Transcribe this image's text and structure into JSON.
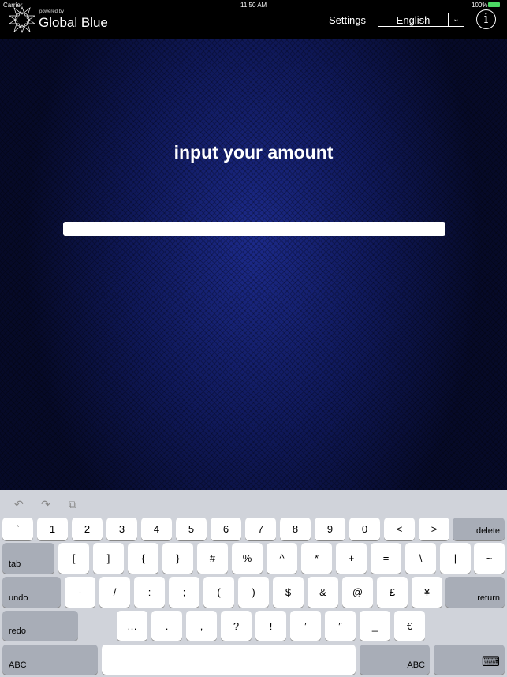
{
  "status": {
    "carrier": "Carrier",
    "time": "11:50 AM",
    "battery": "100%"
  },
  "header": {
    "powered_by": "powered by",
    "brand": "Global Blue",
    "settings": "Settings",
    "language": "English",
    "info": "i"
  },
  "main": {
    "title": "input your amount",
    "amount_value": ""
  },
  "keyboard": {
    "toolbar": [
      "undo-icon",
      "redo-icon",
      "paste-icon"
    ],
    "rows": [
      [
        "`",
        "1",
        "2",
        "3",
        "4",
        "5",
        "6",
        "7",
        "8",
        "9",
        "0",
        "<",
        ">",
        "delete"
      ],
      [
        "tab",
        "[",
        "]",
        "{",
        "}",
        "#",
        "%",
        "^",
        "*",
        "+",
        "=",
        "\\",
        "|",
        "~"
      ],
      [
        "undo",
        "-",
        "/",
        ":",
        ";",
        "(",
        ")",
        "$",
        "&",
        "@",
        "£",
        "¥",
        "return"
      ],
      [
        "redo",
        "…",
        ".",
        ",",
        "?",
        "!",
        "′",
        "″",
        "_",
        "€"
      ],
      [
        "ABC",
        " ",
        "ABC",
        "⌨"
      ]
    ]
  }
}
